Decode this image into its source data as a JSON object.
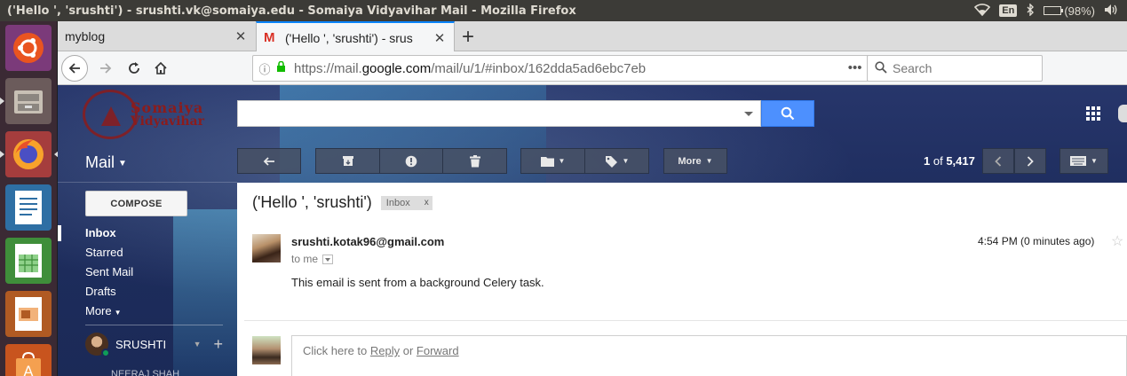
{
  "os": {
    "window_title": "('Hello ', 'srushti') - srushti.vk@somaiya.edu - Somaiya Vidyavihar Mail - Mozilla Firefox",
    "keyboard_layout": "En",
    "battery": "(98%)"
  },
  "launcher": {
    "items": [
      "ubuntu-dash",
      "files",
      "firefox",
      "libreoffice-writer",
      "libreoffice-calc",
      "libreoffice-impress",
      "ubuntu-software"
    ]
  },
  "browser": {
    "tabs": [
      {
        "label": "myblog",
        "active": false
      },
      {
        "label": "('Hello ', 'srushti') - srus",
        "active": true,
        "favicon": "M"
      }
    ],
    "url_prefix": "https://mail.",
    "url_domain": "google.com",
    "url_path": "/mail/u/1/#inbox/162dda5ad6ebc7eb",
    "search_placeholder": "Search"
  },
  "gmail": {
    "logo_line1": "Somaiya",
    "logo_line2": "Vidyavihar",
    "mail_label": "Mail",
    "more_label": "More",
    "pager_current": "1",
    "pager_of": "of",
    "pager_total": "5,417",
    "compose_label": "COMPOSE",
    "nav": [
      {
        "label": "Inbox",
        "active": true
      },
      {
        "label": "Starred",
        "active": false
      },
      {
        "label": "Sent Mail",
        "active": false
      },
      {
        "label": "Drafts",
        "active": false
      },
      {
        "label": "More",
        "active": false
      }
    ],
    "hangouts_user": "SRUSHTI",
    "next_contact": "NEERAJ SHAH"
  },
  "message": {
    "subject": "('Hello ', 'srushti')",
    "tag": "Inbox",
    "tag_close": "x",
    "sender": "srushti.kotak96@gmail.com",
    "to": "to me",
    "time": "4:54 PM (0 minutes ago)",
    "body": "This email is sent from a background Celery task.",
    "reply_prefix": "Click here to ",
    "reply_link": "Reply",
    "reply_or": " or ",
    "forward_link": "Forward"
  },
  "colors": {
    "accent": "#4d90fe",
    "firefox_tab_highlight": "#0a84ff",
    "online": "#0f9d58"
  }
}
